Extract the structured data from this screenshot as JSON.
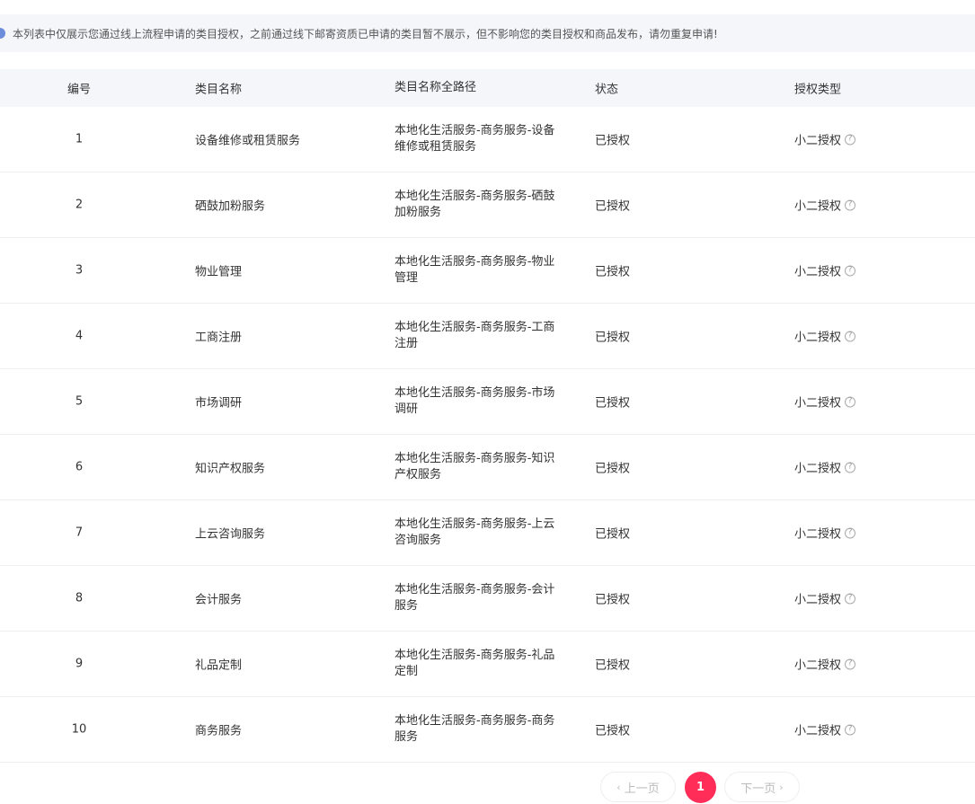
{
  "notice": {
    "text": "本列表中仅展示您通过线上流程申请的类目授权，之前通过线下邮寄资质已申请的类目暂不展示，但不影响您的类目授权和商品发布，请勿重复申请!"
  },
  "table": {
    "headers": {
      "no": "编号",
      "name": "类目名称",
      "path": "类目名称全路径",
      "state": "状态",
      "type": "授权类型"
    },
    "rows": [
      {
        "no": "1",
        "name": "设备维修或租赁服务",
        "path": "本地化生活服务-商务服务-设备维修或租赁服务",
        "state": "已授权",
        "type": "小二授权"
      },
      {
        "no": "2",
        "name": "硒鼓加粉服务",
        "path": "本地化生活服务-商务服务-硒鼓加粉服务",
        "state": "已授权",
        "type": "小二授权"
      },
      {
        "no": "3",
        "name": "物业管理",
        "path": "本地化生活服务-商务服务-物业管理",
        "state": "已授权",
        "type": "小二授权"
      },
      {
        "no": "4",
        "name": "工商注册",
        "path": "本地化生活服务-商务服务-工商注册",
        "state": "已授权",
        "type": "小二授权"
      },
      {
        "no": "5",
        "name": "市场调研",
        "path": "本地化生活服务-商务服务-市场调研",
        "state": "已授权",
        "type": "小二授权"
      },
      {
        "no": "6",
        "name": "知识产权服务",
        "path": "本地化生活服务-商务服务-知识产权服务",
        "state": "已授权",
        "type": "小二授权"
      },
      {
        "no": "7",
        "name": "上云咨询服务",
        "path": "本地化生活服务-商务服务-上云咨询服务",
        "state": "已授权",
        "type": "小二授权"
      },
      {
        "no": "8",
        "name": "会计服务",
        "path": "本地化生活服务-商务服务-会计服务",
        "state": "已授权",
        "type": "小二授权"
      },
      {
        "no": "9",
        "name": "礼品定制",
        "path": "本地化生活服务-商务服务-礼品定制",
        "state": "已授权",
        "type": "小二授权"
      },
      {
        "no": "10",
        "name": "商务服务",
        "path": "本地化生活服务-商务服务-商务服务",
        "state": "已授权",
        "type": "小二授权"
      }
    ]
  },
  "pagination": {
    "prev_label": "上一页",
    "current": "1",
    "next_label": "下一页"
  },
  "icons": {
    "help": "help-circle-icon",
    "info": "info-icon"
  },
  "colors": {
    "accent": "#ff2d58",
    "header_bg": "#f5f6fa"
  }
}
